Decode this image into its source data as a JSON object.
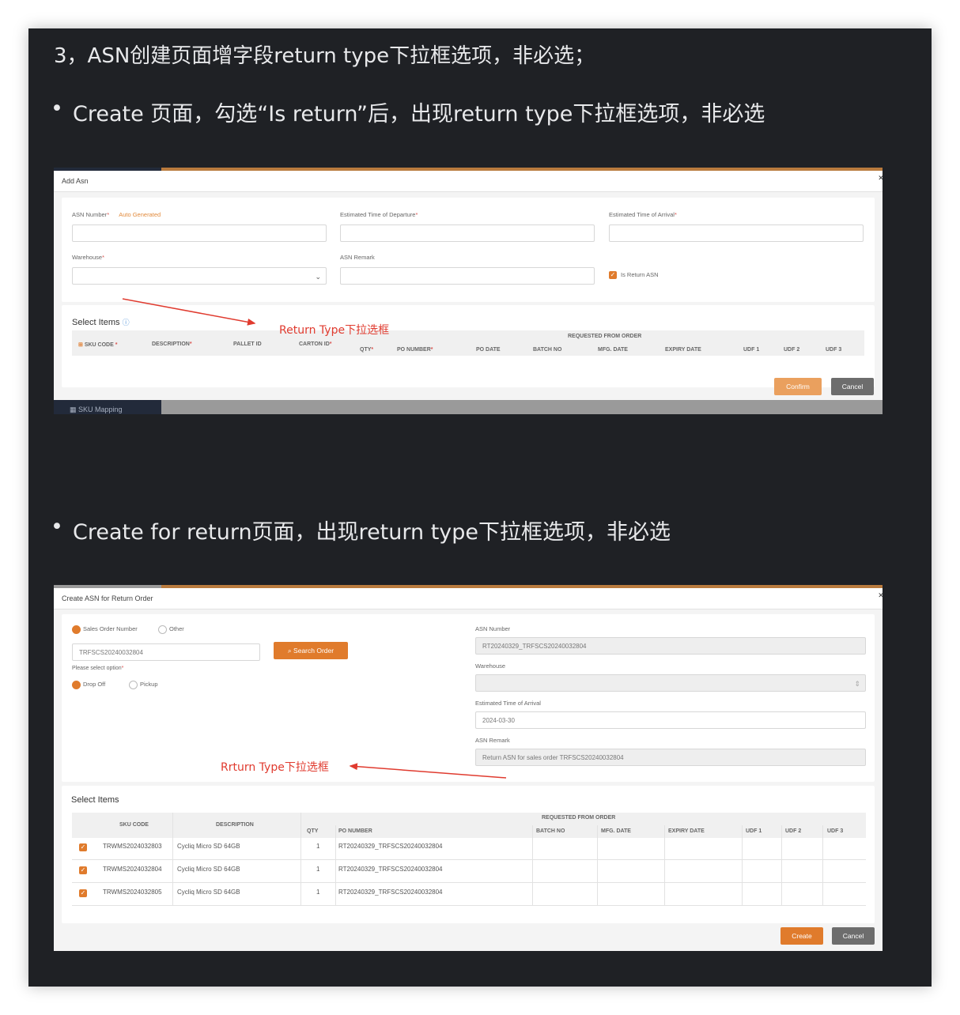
{
  "heading": "3，ASN创建页面增字段return type下拉框选项，非必选；",
  "bullet1": "Create 页面，勾选“Is return”后，出现return type下拉框选项，非必选",
  "bullet2": "Create for return页面，出现return type下拉框选项，非必选",
  "shot1": {
    "bg_sidebar_item": "SKU Mapping",
    "modal_title": "Add Asn",
    "asn_number_label": "ASN Number",
    "auto_generated": "Auto Generated",
    "etd_label": "Estimated Time of Departure",
    "eta_label": "Estimated Time of Arrival",
    "warehouse_label": "Warehouse",
    "asn_remark_label": "ASN Remark",
    "is_return_label": "Is Return ASN",
    "select_items": "Select Items",
    "requested_from_order": "REQUESTED FROM ORDER",
    "columns": [
      "SKU CODE",
      "DESCRIPTION",
      "PALLET ID",
      "CARTON ID",
      "QTY",
      "PO NUMBER",
      "PO DATE",
      "BATCH NO",
      "MFG. DATE",
      "EXPIRY DATE",
      "UDF 1",
      "UDF 2",
      "UDF 3"
    ],
    "annotation": "Return Type下拉选框",
    "confirm": "Confirm",
    "cancel": "Cancel"
  },
  "shot2": {
    "modal_title": "Create ASN for Return Order",
    "radio_sales_order": "Sales Order Number",
    "radio_other": "Other",
    "order_value": "TRFSCS20240032804",
    "search_order": "Search Order",
    "please_select": "Please select option",
    "drop_off": "Drop Off",
    "pickup": "Pickup",
    "asn_number_label": "ASN Number",
    "asn_number_value": "RT20240329_TRFSCS20240032804",
    "warehouse_label": "Warehouse",
    "eta_label": "Estimated Time of Arrival",
    "eta_value": "2024-03-30",
    "asn_remark_label": "ASN Remark",
    "asn_remark_value": "Return ASN for sales order TRFSCS20240032804",
    "annotation": "Rrturn Type下拉选框",
    "select_items": "Select Items",
    "requested_from_order": "REQUESTED FROM ORDER",
    "columns": [
      "SKU CODE",
      "DESCRIPTION",
      "QTY",
      "PO NUMBER",
      "BATCH NO",
      "MFG. DATE",
      "EXPIRY DATE",
      "UDF 1",
      "UDF 2",
      "UDF 3"
    ],
    "rows": [
      {
        "sku": "TRWMS2024032803",
        "desc": "Cycliq Micro SD 64GB",
        "qty": "1",
        "po": "RT20240329_TRFSCS20240032804"
      },
      {
        "sku": "TRWMS2024032804",
        "desc": "Cycliq Micro SD 64GB",
        "qty": "1",
        "po": "RT20240329_TRFSCS20240032804"
      },
      {
        "sku": "TRWMS2024032805",
        "desc": "Cycliq Micro SD 64GB",
        "qty": "1",
        "po": "RT20240329_TRFSCS20240032804"
      }
    ],
    "create": "Create",
    "cancel": "Cancel"
  },
  "colors": {
    "accent": "#e07b2c",
    "annotation": "#e03b2f",
    "doc_bg": "#1f2125"
  }
}
